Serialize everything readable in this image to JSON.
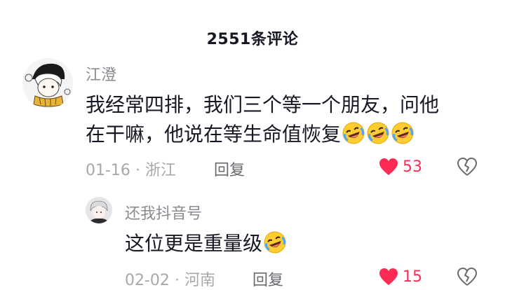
{
  "header": {
    "title": "2551条评论"
  },
  "comments": [
    {
      "nickname": "江澄",
      "text_line1": "我经常四排，我们三个等一个朋友，问他",
      "text_line2": "在干嘛，他说在等生命值恢复",
      "emoji": "rolling-on-floor-laughing-emoji",
      "emoji_count": 3,
      "date": "01-16",
      "location": "浙江",
      "reply_label": "回复",
      "likes": "53",
      "liked": true
    }
  ],
  "replies": [
    {
      "nickname": "还我抖音号",
      "text": "这位更是重量级",
      "emoji": "rolling-on-floor-laughing-emoji",
      "date": "02-02",
      "location": "河南",
      "reply_label": "回复",
      "likes": "15",
      "liked": true
    }
  ],
  "colors": {
    "like_red": "#fe2c55",
    "meta_gray": "#a7a8ac",
    "name_gray": "#8a8b91"
  }
}
